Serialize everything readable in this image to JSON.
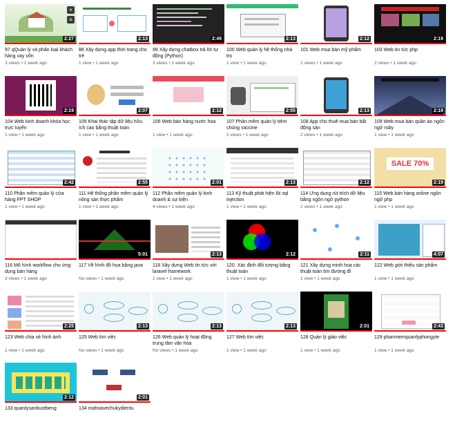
{
  "videos": [
    {
      "title": "97 qQuản lý và phân loại khách hàng vay vốn",
      "duration": "2:27",
      "meta": "3 views • 1 week ago",
      "theme": "house"
    },
    {
      "title": "98 Xây dựng app thời trang cho trẻ",
      "duration": "2:13",
      "meta": "1 view • 1 week ago",
      "theme": "fashion"
    },
    {
      "title": "99 Xây dựng chatbox trả lời tự động (Python)",
      "duration": "2:49",
      "meta": "3 views • 1 week ago",
      "theme": "code"
    },
    {
      "title": "100 Web quản lý hệ thống nhà trọ",
      "duration": "2:13",
      "meta": "1 view • 1 week ago",
      "theme": "form"
    },
    {
      "title": "101 Web mua bán mỹ phẩm",
      "duration": "2:12",
      "meta": "2 views • 1 week ago",
      "theme": "phone"
    },
    {
      "title": "103 Web tin tức php",
      "duration": "2:19",
      "meta": "2 views • 1 week ago",
      "theme": "darkweb"
    },
    {
      "title": "104 Web kinh doanh khóa học trực tuyến",
      "duration": "2:19",
      "meta": "1 view • 1 week ago",
      "theme": "qr"
    },
    {
      "title": "105 Khai thác tập dữ liệu hữu ích cao bằng thuật toán",
      "duration": "2:07",
      "meta": "1 view • 1 week ago",
      "theme": "login"
    },
    {
      "title": "106 Web bán hàng nước hoa",
      "duration": "2:12",
      "meta": "1 view • 1 week ago",
      "theme": "perfume"
    },
    {
      "title": "107 Phần mềm quản lý tiêm chủng vaccine",
      "duration": "2:55",
      "meta": "2 views • 1 week ago",
      "theme": "vaccine"
    },
    {
      "title": "108 App cho thuê mua bán bất động sản",
      "duration": "2:13",
      "meta": "2 views • 1 week ago",
      "theme": "realty"
    },
    {
      "title": "109 Web mua bán quần áo ngôn ngữ ruby",
      "duration": "2:19",
      "meta": "1 view • 1 week ago",
      "theme": "mountain"
    },
    {
      "title": "110 Phần mềm quản lý cửa hàng FPT SHOP",
      "duration": "2:42",
      "meta": "1 view • 1 week ago",
      "theme": "table"
    },
    {
      "title": "111 Hệ thống phần mềm quản lý nông sản thực phẩm",
      "duration": "2:55",
      "meta": "1 view • 1 week ago",
      "theme": "invoice"
    },
    {
      "title": "112 Phần mềm quản lý kinh doanh & sự kiện",
      "duration": "2:01",
      "meta": "4 views • 1 week ago",
      "theme": "diagram"
    },
    {
      "title": "113 Kỹ thuật phát hiện lỗi sql injection",
      "duration": "2:13",
      "meta": "1 view • 1 week ago",
      "theme": "sqlweb"
    },
    {
      "title": "114 Ứng dụng rút trích dữ liệu bằng ngôn ngữ python",
      "duration": "2:12",
      "meta": "2 views • 1 week ago",
      "theme": "excel"
    },
    {
      "title": "115 Web bán hàng online ngôn ngữ php",
      "duration": "2:19",
      "meta": "1 view • 1 week ago",
      "theme": "sale"
    },
    {
      "title": "116 Mô hình workflow cho ứng dụng bán hàng",
      "duration": "",
      "meta": "3 views • 1 week ago",
      "theme": "blank"
    },
    {
      "title": "117 Vẽ hình đồ họa bằng java",
      "duration": "5:01",
      "meta": "No views • 1 week ago",
      "theme": "graphics"
    },
    {
      "title": "118 Xây dựng Web tin tức với laravel framework",
      "duration": "2:13",
      "meta": "1 view • 1 week ago",
      "theme": "news"
    },
    {
      "title": "120. Xác định đối tượng bằng thuật toán",
      "duration": "2:12",
      "meta": "1 view • 1 week ago",
      "theme": "rgb"
    },
    {
      "title": "121 Xây dựng minh họa các thuật toán tìm đường đi",
      "duration": "2:11",
      "meta": "1 view • 1 week ago",
      "theme": "graph"
    },
    {
      "title": "122 Web giới thiệu sản phẩm",
      "duration": "4:07",
      "meta": "1 view • 1 week ago",
      "theme": "product"
    },
    {
      "title": "123 Web chia sẻ hình ảnh",
      "duration": "2:25",
      "meta": "1 view • 1 week ago",
      "theme": "gallery"
    },
    {
      "title": "125 Web tìm việc",
      "duration": "2:13",
      "meta": "No views • 1 week ago",
      "theme": "flow"
    },
    {
      "title": "126 Web quản lý hoạt động trung tâm văn hóa",
      "duration": "2:13",
      "meta": "No views • 1 week ago",
      "theme": "flow"
    },
    {
      "title": "127 Web tìm việc",
      "duration": "2:13",
      "meta": "1 view • 1 week ago",
      "theme": "flow"
    },
    {
      "title": "128 Quản lý giáo việc",
      "duration": "2:01",
      "meta": "1 view • 1 week ago",
      "theme": "greenapp"
    },
    {
      "title": "129 phanmemquanlyphongyte",
      "duration": "2:43",
      "meta": "1 view • 1 week ago",
      "theme": "medform"
    },
    {
      "title": "133 quanlysanbuotbeng",
      "duration": "2:12",
      "meta": "",
      "theme": "cyan"
    },
    {
      "title": "134 mahoavechukydientu",
      "duration": "2:01",
      "meta": "",
      "theme": "keys"
    }
  ],
  "first_card_icons": [
    "close-icon",
    "queue-icon"
  ],
  "menu_glyph": "⋮",
  "progress_color": "#ff0000"
}
